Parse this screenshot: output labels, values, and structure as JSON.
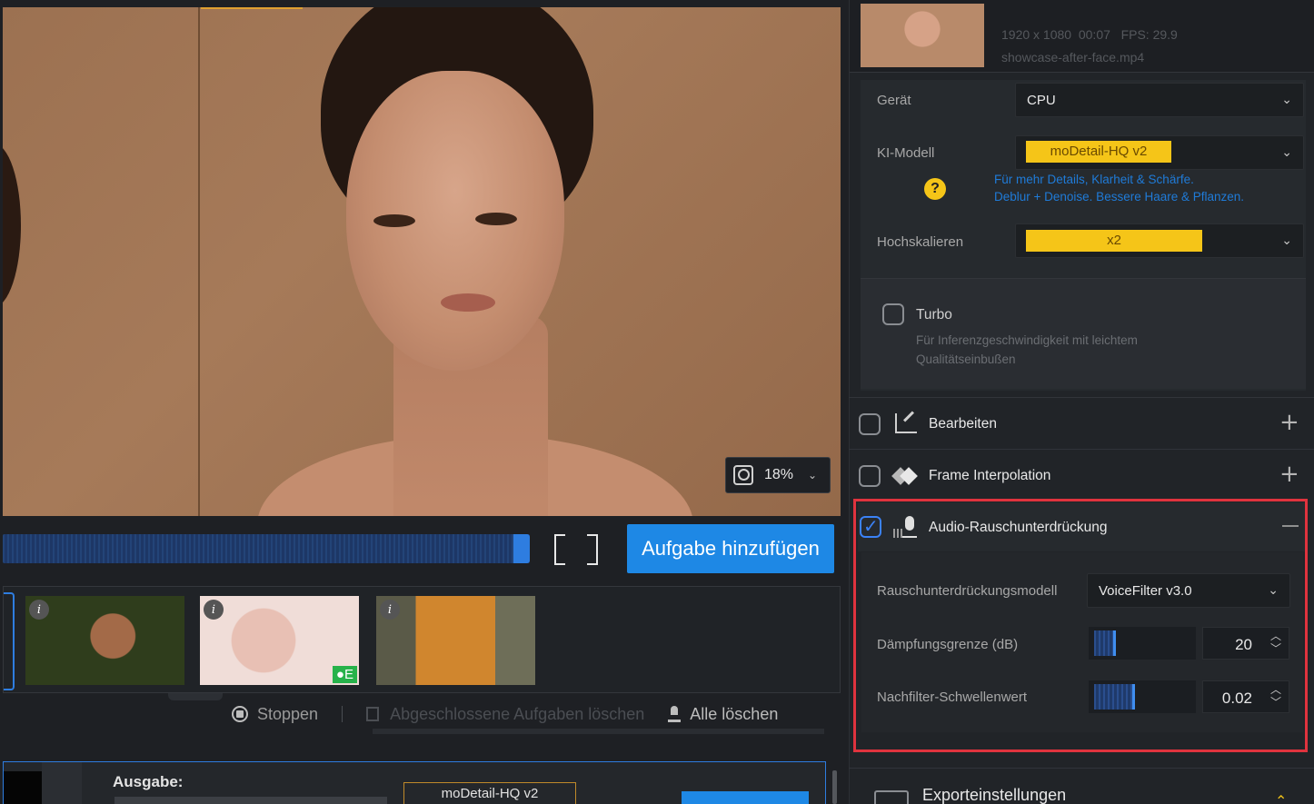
{
  "preview": {
    "zoom_value": "18%"
  },
  "timeline": {
    "add_task_label": "Aufgabe hinzufügen"
  },
  "tasks": {
    "thumb2_badge": "●E"
  },
  "controls": {
    "stop_label": "Stoppen",
    "clear_done_label": "Abgeschlossene Aufgaben löschen",
    "clear_all_label": "Alle löschen"
  },
  "output": {
    "label": "Ausgabe:",
    "model": "moDetail-HQ  v2"
  },
  "video_info": {
    "resolution": "1920 x 1080",
    "duration": "00:07",
    "fps": "FPS: 29.9",
    "filename": "showcase-after-face.mp4"
  },
  "settings": {
    "device_label": "Gerät",
    "device_value": "CPU",
    "model_label": "KI-Modell",
    "model_value": "moDetail-HQ  v2",
    "model_hint_1": "Für mehr Details, Klarheit & Schärfe.",
    "model_hint_2": "Deblur + Denoise. Bessere Haare & Pflanzen.",
    "upscale_label": "Hochskalieren",
    "upscale_value": "x2",
    "turbo_label": "Turbo",
    "turbo_desc_1": "Für Inferenzgeschwindigkeit mit leichtem",
    "turbo_desc_2": "Qualitätseinbußen"
  },
  "sections": {
    "edit": "Bearbeiten",
    "frame_interp": "Frame Interpolation",
    "audio": "Audio-Rauschunterdrückung"
  },
  "audio": {
    "model_label": "Rauschunterdrückungsmodell",
    "model_value": "VoiceFilter v3.0",
    "damping_label": "Dämpfungsgrenze (dB)",
    "damping_value": "20",
    "damping_fraction": 0.2,
    "threshold_label": "Nachfilter-Schwellenwert",
    "threshold_value": "0.02",
    "threshold_fraction": 0.4
  },
  "export": {
    "label": "Exporteinstellungen"
  }
}
